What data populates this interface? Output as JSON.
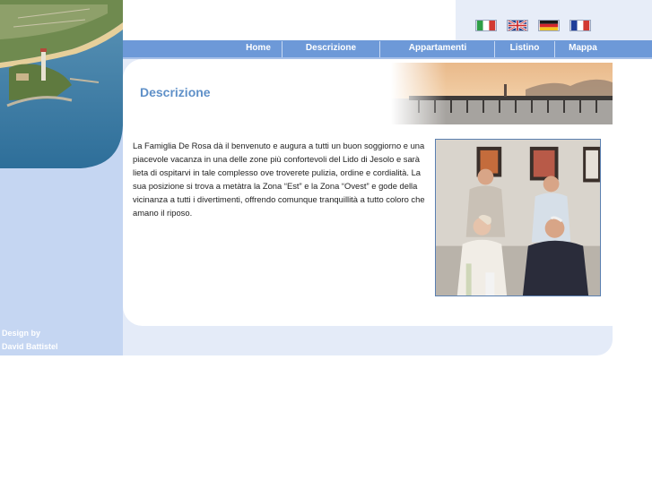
{
  "nav": {
    "items": [
      "Home",
      "Descrizione",
      "Appartamenti",
      "Listino",
      "Mappa"
    ]
  },
  "flags": [
    "italian-flag-icon",
    "english-flag-icon",
    "german-flag-icon",
    "french-flag-icon"
  ],
  "page": {
    "title": "Descrizione",
    "body": "La Famiglia De Rosa dà il benvenuto e augura a tutti un buon soggiorno e una piacevole vacanza in una delle zone più confortevoli del Lido di Jesolo e sarà lieta di ospitarvi in tale complesso ove troverete pulizia, ordine e cordialità. La sua posizione si trova a metàtra la Zona “Est” e la Zona “Ovest” e gode della vicinanza a tutti i divertimenti, offrendo comunque tranquillità a tutto coloro che amano il riposo."
  },
  "credit": {
    "line1": "Design by",
    "line2": "David Battistel"
  },
  "colors": {
    "nav_bar": "#6d99d8",
    "sidebar": "#c5d6f2",
    "title": "#5f90c8"
  }
}
